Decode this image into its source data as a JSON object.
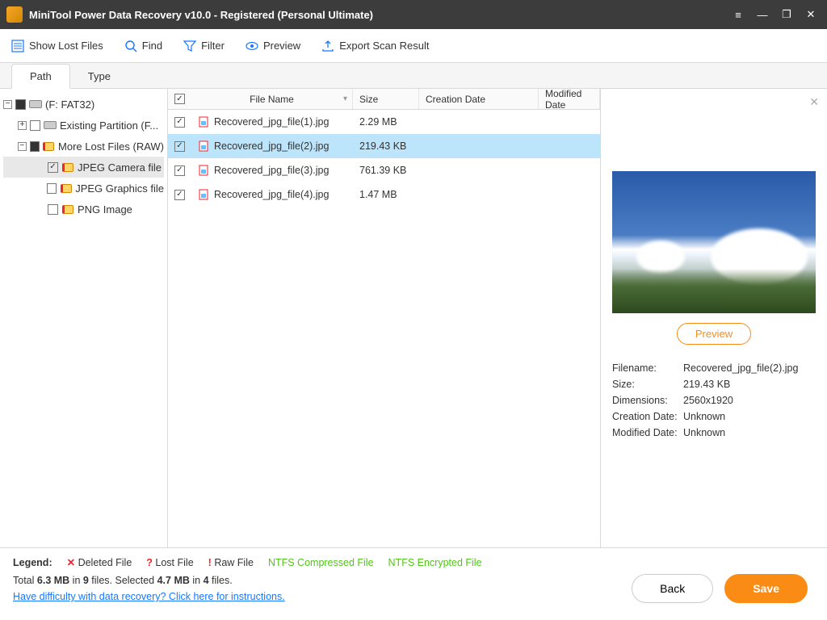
{
  "titlebar": {
    "title": "MiniTool Power Data Recovery v10.0 - Registered (Personal Ultimate)"
  },
  "toolbar": {
    "show_lost": "Show Lost Files",
    "find": "Find",
    "filter": "Filter",
    "preview": "Preview",
    "export": "Export Scan Result"
  },
  "tabs": {
    "path": "Path",
    "type": "Type"
  },
  "tree": {
    "root": "(F: FAT32)",
    "existing": "Existing Partition (F...",
    "more_lost": "More Lost Files (RAW)",
    "jpeg_camera": "JPEG Camera file",
    "jpeg_graphics": "JPEG Graphics file",
    "png_image": "PNG Image"
  },
  "columns": {
    "name": "File Name",
    "size": "Size",
    "creation": "Creation Date",
    "modified": "Modified Date"
  },
  "files": [
    {
      "name": "Recovered_jpg_file(1).jpg",
      "size": "2.29 MB"
    },
    {
      "name": "Recovered_jpg_file(2).jpg",
      "size": "219.43 KB"
    },
    {
      "name": "Recovered_jpg_file(3).jpg",
      "size": "761.39 KB"
    },
    {
      "name": "Recovered_jpg_file(4).jpg",
      "size": "1.47 MB"
    }
  ],
  "preview": {
    "button": "Preview",
    "filename_k": "Filename:",
    "filename_v": "Recovered_jpg_file(2).jpg",
    "size_k": "Size:",
    "size_v": "219.43 KB",
    "dim_k": "Dimensions:",
    "dim_v": "2560x1920",
    "creation_k": "Creation Date:",
    "creation_v": "Unknown",
    "modified_k": "Modified Date:",
    "modified_v": "Unknown"
  },
  "footer": {
    "legend_label": "Legend:",
    "deleted": "Deleted File",
    "lost": "Lost File",
    "raw": "Raw File",
    "ntfs_comp": "NTFS Compressed File",
    "ntfs_enc": "NTFS Encrypted File",
    "totals_pre": "Total ",
    "totals_size": "6.3 MB",
    "totals_mid1": " in ",
    "totals_count": "9",
    "totals_mid2": " files.  Selected ",
    "sel_size": "4.7 MB",
    "sel_mid": " in ",
    "sel_count": "4",
    "sel_end": " files.",
    "help": "Have difficulty with data recovery? Click here for instructions.",
    "back": "Back",
    "save": "Save"
  }
}
